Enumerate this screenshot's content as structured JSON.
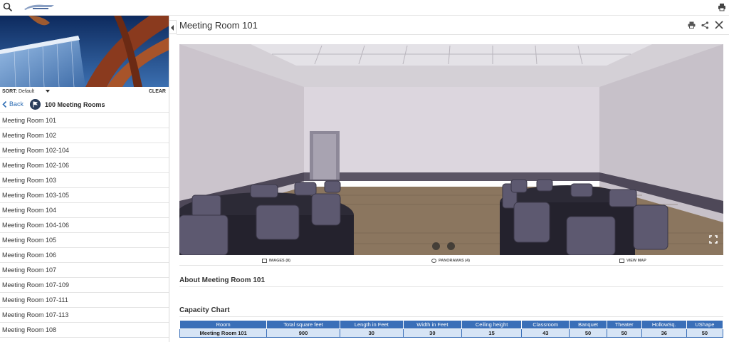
{
  "header": {
    "icons": [
      "search-icon",
      "logo",
      "print-icon"
    ]
  },
  "sidebar": {
    "sort_label": "SORT:",
    "sort_value": "Default",
    "clear_label": "CLEAR",
    "back_label": "Back",
    "category_title": "100 Meeting Rooms",
    "rooms": [
      "Meeting Room 101",
      "Meeting Room 102",
      "Meeting Room 102-104",
      "Meeting Room 102-106",
      "Meeting Room 103",
      "Meeting Room 103-105",
      "Meeting Room 104",
      "Meeting Room 104-106",
      "Meeting Room 105",
      "Meeting Room 106",
      "Meeting Room 107",
      "Meeting Room 107-109",
      "Meeting Room 107-111",
      "Meeting Room 107-113",
      "Meeting Room 108"
    ]
  },
  "main": {
    "title": "Meeting Room 101",
    "media": {
      "images_label": "IMAGES (8)",
      "panoramas_label": "PANORAMAS (4)",
      "map_label": "VIEW MAP"
    },
    "about_heading": "About Meeting Room 101",
    "capacity_heading": "Capacity Chart",
    "capacity_table": {
      "headers": [
        "Room",
        "Total square feet",
        "Length in Feet",
        "Width in Feet",
        "Ceiling height",
        "Classroom",
        "Banquet",
        "Theater",
        "HollowSq.",
        "UShape"
      ],
      "row": [
        "Meeting Room 101",
        "900",
        "30",
        "30",
        "15",
        "43",
        "50",
        "50",
        "36",
        "50"
      ]
    }
  },
  "colors": {
    "link": "#2e6db4",
    "table_header": "#3a6fb8",
    "table_row": "#d6e4f5"
  }
}
